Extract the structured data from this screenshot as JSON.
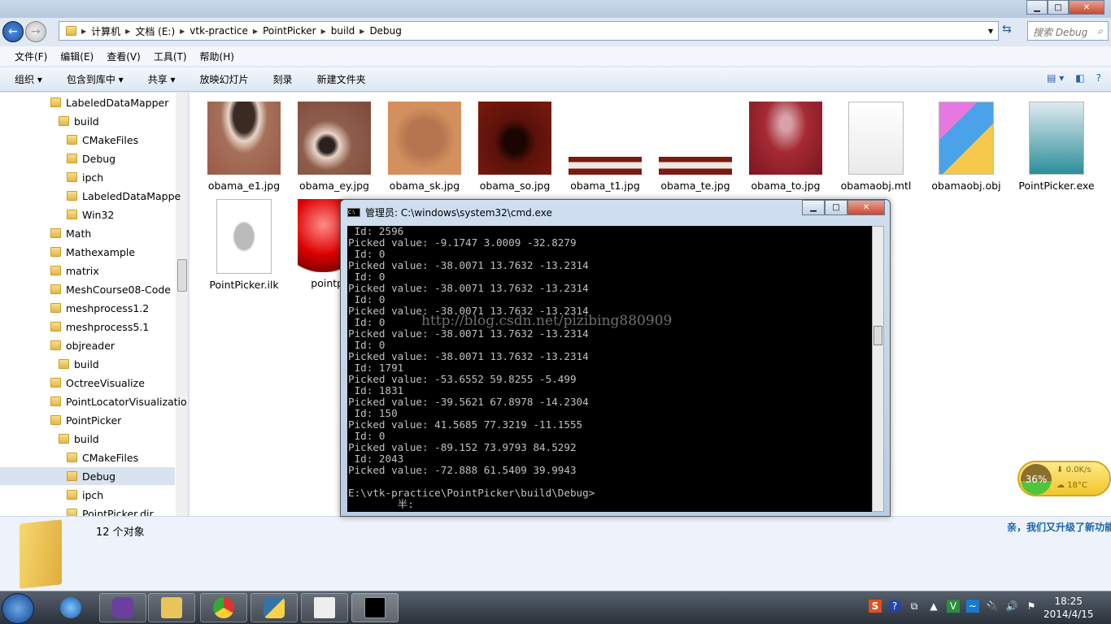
{
  "address": {
    "crumbs": [
      "计算机",
      "文档 (E:)",
      "vtk-practice",
      "PointPicker",
      "build",
      "Debug"
    ],
    "search_placeholder": "搜索 Debug"
  },
  "menu": [
    "文件(F)",
    "编辑(E)",
    "查看(V)",
    "工具(T)",
    "帮助(H)"
  ],
  "toolbar": [
    "组织 ▾",
    "包含到库中 ▾",
    "共享 ▾",
    "放映幻灯片",
    "刻录",
    "新建文件夹"
  ],
  "sidebar": [
    {
      "label": "LabeledDataMapper",
      "level": 0
    },
    {
      "label": "build",
      "level": 1
    },
    {
      "label": "CMakeFiles",
      "level": 2
    },
    {
      "label": "Debug",
      "level": 2
    },
    {
      "label": "ipch",
      "level": 2
    },
    {
      "label": "LabeledDataMappe",
      "level": 2
    },
    {
      "label": "Win32",
      "level": 2
    },
    {
      "label": "Math",
      "level": 0
    },
    {
      "label": "Mathexample",
      "level": 0
    },
    {
      "label": "matrix",
      "level": 0
    },
    {
      "label": "MeshCourse08-Code",
      "level": 0
    },
    {
      "label": "meshprocess1.2",
      "level": 0
    },
    {
      "label": "meshprocess5.1",
      "level": 0
    },
    {
      "label": "objreader",
      "level": 0
    },
    {
      "label": "build",
      "level": 1
    },
    {
      "label": "OctreeVisualize",
      "level": 0
    },
    {
      "label": "PointLocatorVisualizatio",
      "level": 0
    },
    {
      "label": "PointPicker",
      "level": 0
    },
    {
      "label": "build",
      "level": 1
    },
    {
      "label": "CMakeFiles",
      "level": 2
    },
    {
      "label": "Debug",
      "level": 2,
      "selected": true
    },
    {
      "label": "ipch",
      "level": 2
    },
    {
      "label": "PointPicker.dir",
      "level": 2
    }
  ],
  "files": [
    {
      "name": "obama_e1.jpg",
      "kind": "eye"
    },
    {
      "name": "obama_ey.jpg",
      "kind": "eye2"
    },
    {
      "name": "obama_sk.jpg",
      "kind": "face"
    },
    {
      "name": "obama_so.jpg",
      "kind": "mouth"
    },
    {
      "name": "obama_t1.jpg",
      "kind": "teeth"
    },
    {
      "name": "obama_te.jpg",
      "kind": "teeth"
    },
    {
      "name": "obama_to.jpg",
      "kind": "tongue"
    },
    {
      "name": "obamaobj.mtl",
      "kind": "doc"
    },
    {
      "name": "obamaobj.obj",
      "kind": "obj"
    },
    {
      "name": "PointPicker.exe",
      "kind": "exe"
    },
    {
      "name": "PointPicker.ilk",
      "kind": "ilk"
    },
    {
      "name": "pointpick",
      "kind": "ball"
    }
  ],
  "status": {
    "count": "12 个对象",
    "promo": "亲，我们又升级了新功能"
  },
  "widget": {
    "percent": "36%",
    "download": "0.0K/s",
    "weather": "18°C"
  },
  "cmd": {
    "title": "管理员: C:\\windows\\system32\\cmd.exe",
    "lines": [
      " Id: 2596",
      "Picked value: -9.1747 3.0009 -32.8279",
      " Id: 0",
      "Picked value: -38.0071 13.7632 -13.2314",
      " Id: 0",
      "Picked value: -38.0071 13.7632 -13.2314",
      " Id: 0",
      "Picked value: -38.0071 13.7632 -13.2314",
      " Id: 0",
      "Picked value: -38.0071 13.7632 -13.2314",
      " Id: 0",
      "Picked value: -38.0071 13.7632 -13.2314",
      " Id: 1791",
      "Picked value: -53.6552 59.8255 -5.499",
      " Id: 1831",
      "Picked value: -39.5621 67.8978 -14.2304",
      " Id: 150",
      "Picked value: 41.5685 77.3219 -11.1555",
      " Id: 0",
      "Picked value: -89.152 73.9793 84.5292",
      " Id: 2043",
      "Picked value: -72.888 61.5409 39.9943",
      "",
      "E:\\vtk-practice\\PointPicker\\build\\Debug>",
      "        半:"
    ],
    "watermark": "http://blog.csdn.net/pizibing880909"
  },
  "clock": {
    "time": "18:25",
    "date": "2014/4/15"
  }
}
